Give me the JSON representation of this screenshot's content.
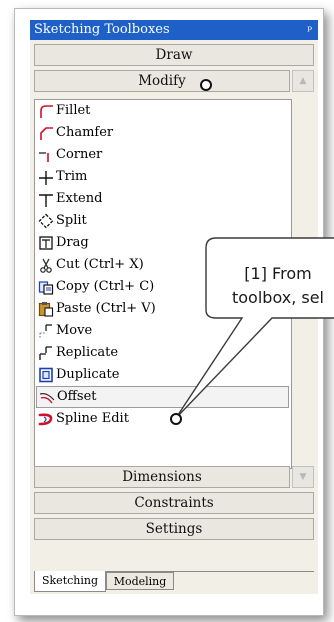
{
  "window": {
    "title": "Sketching Toolboxes",
    "pin_glyph": "ᵖ"
  },
  "sections": {
    "draw": "Draw",
    "modify": "Modify",
    "dimensions": "Dimensions",
    "constraints": "Constraints",
    "settings": "Settings"
  },
  "scroll": {
    "up_glyph": "▲",
    "down_glyph": "▼"
  },
  "modify_items": [
    {
      "label": "Fillet",
      "icon": "fillet-icon"
    },
    {
      "label": "Chamfer",
      "icon": "chamfer-icon"
    },
    {
      "label": "Corner",
      "icon": "corner-icon"
    },
    {
      "label": "Trim",
      "icon": "trim-icon"
    },
    {
      "label": "Extend",
      "icon": "extend-icon"
    },
    {
      "label": "Split",
      "icon": "split-icon"
    },
    {
      "label": "Drag",
      "icon": "drag-icon"
    },
    {
      "label": "Cut (Ctrl+ X)",
      "icon": "cut-icon"
    },
    {
      "label": "Copy (Ctrl+ C)",
      "icon": "copy-icon"
    },
    {
      "label": "Paste (Ctrl+ V)",
      "icon": "paste-icon"
    },
    {
      "label": "Move",
      "icon": "move-icon"
    },
    {
      "label": "Replicate",
      "icon": "replicate-icon"
    },
    {
      "label": "Duplicate",
      "icon": "duplicate-icon"
    },
    {
      "label": "Offset",
      "icon": "offset-icon",
      "selected": true
    },
    {
      "label": "Spline Edit",
      "icon": "spline-edit-icon"
    }
  ],
  "tabs": {
    "sketching": "Sketching",
    "modeling": "Modeling",
    "active": "Sketching"
  },
  "callout": {
    "line1": "[1] From",
    "line2": "toolbox, sel"
  },
  "colors": {
    "title_bar": "#1e5fc8",
    "panel": "#f1efe6",
    "accent_red": "#d0102a",
    "accent_blue": "#1b3fb0"
  }
}
